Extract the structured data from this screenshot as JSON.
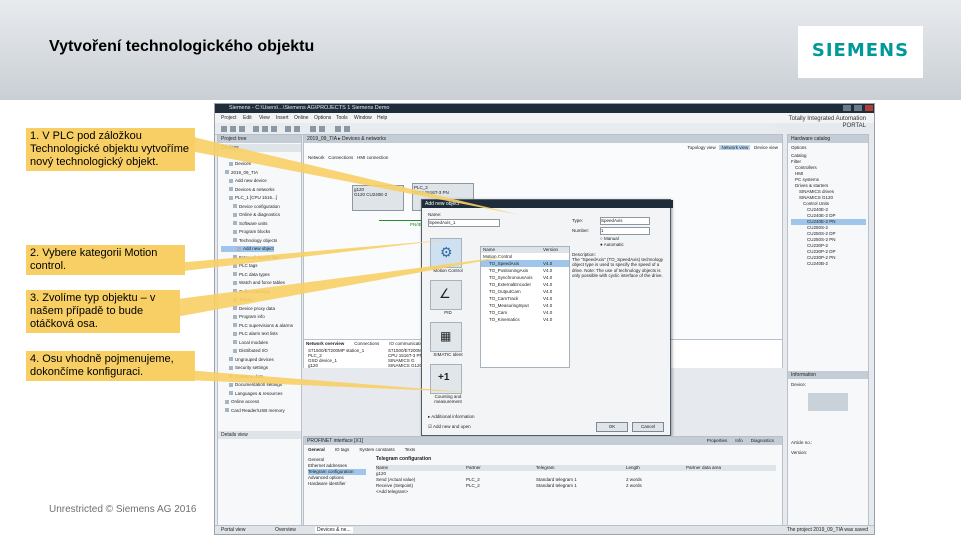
{
  "slide": {
    "title": "Vytvoření technologického objektu",
    "logo": "SIEMENS",
    "footer": "Unrestricted © Siemens AG 2016"
  },
  "callouts": [
    {
      "text": "1. V PLC pod záložkou Technologické objektu vytvoříme nový technologický objekt."
    },
    {
      "text": "2. Vybere kategorii Motion control."
    },
    {
      "text": "3. Zvolíme typ objektu – v našem případě to bude otáčková osa."
    },
    {
      "text": "4. Osu vhodně pojmenujeme, dokončíme konfiguraci."
    }
  ],
  "accent_colors": {
    "callout": "#f7cf65",
    "logo": "#009999",
    "title_bar": "#1f2d3b"
  },
  "tia": {
    "window_title": "Siemens - C:\\Users\\...\\Siemens AG\\PROJECTS 1 Siemens Demo",
    "brand_line1": "Totally Integrated Automation",
    "brand_line2": "PORTAL",
    "menu": [
      "Project",
      "Edit",
      "View",
      "Insert",
      "Online",
      "Options",
      "Tools",
      "Window",
      "Help"
    ],
    "project_tree_title": "Project tree",
    "devices_tab": "Devices",
    "tree_items": [
      "Devices",
      "2019_09_TIA",
      "Add new device",
      "Devices & networks",
      "PLC_1 [CPU 1516...]",
      "Device configuration",
      "Online & diagnostics",
      "Software units",
      "Program blocks",
      "Technology objects",
      "Add new object",
      "External source files",
      "PLC tags",
      "PLC data types",
      "Watch and force tables",
      "Online backups",
      "Traces",
      "Device proxy data",
      "Program info",
      "PLC supervisions & alarms",
      "PLC alarm text lists",
      "Local modules",
      "Distributed I/O",
      "Ungrouped devices",
      "Security settings",
      "Common data",
      "Documentation settings",
      "Languages & resources",
      "Online access",
      "Card Reader/USB memory"
    ],
    "details_view": "Details view",
    "breadcrumb": "2019_09_TIA ▸ Devices & networks",
    "view_tabs": [
      "Topology view",
      "Network view",
      "Device view"
    ],
    "net_toolbar": [
      "Network",
      "Connections",
      "HMI connection"
    ],
    "devices": [
      {
        "name": "g120",
        "sub": "G120 CU240E-2"
      },
      {
        "name": "PLC_2",
        "sub": "CPU 1516T-3 PN"
      }
    ],
    "net_label": "PN/IE_1",
    "dialog": {
      "title": "Add new object",
      "name_label": "Name:",
      "name_value": "SpeedAxis_1",
      "categories": [
        "Motion Control",
        "PID",
        "SIMATIC Ident",
        "Counting and measurement"
      ],
      "list_header": [
        "Name",
        "Version"
      ],
      "list_items": [
        {
          "name": "Motion Control",
          "ver": ""
        },
        {
          "name": "TO_SpeedAxis",
          "ver": "V4.0"
        },
        {
          "name": "TO_PositioningAxis",
          "ver": "V4.0"
        },
        {
          "name": "TO_SynchronousAxis",
          "ver": "V4.0"
        },
        {
          "name": "TO_ExternalEncoder",
          "ver": "V4.0"
        },
        {
          "name": "TO_OutputCam",
          "ver": "V4.0"
        },
        {
          "name": "TO_CamTrack",
          "ver": "V4.0"
        },
        {
          "name": "TO_MeasuringInput",
          "ver": "V4.0"
        },
        {
          "name": "TO_Cam",
          "ver": "V4.0"
        },
        {
          "name": "TO_Kinematics",
          "ver": "V4.0"
        }
      ],
      "type_label": "Type:",
      "type_value": "SpeedAxis",
      "number_label": "Number:",
      "number_value": "1",
      "radio_manual": "Manual",
      "radio_auto": "Automatic",
      "description_label": "Description:",
      "description": "The \"SpeedAxis\" (TO_SpeedAxis) technology object type is used to specify the speed of a drive. Note: The use of technology objects is only possible with cyclic interface of the drive.",
      "additional_info": "Additional information",
      "add_and_open": "Add new and open",
      "ok": "OK",
      "cancel": "Cancel"
    },
    "network_overview_tabs": [
      "Network overview",
      "Connections",
      "IO communication",
      "VPN"
    ],
    "overview_rows": [
      {
        "device": "S71500/ET200MP station_1",
        "type": "S71500/ET200MP station"
      },
      {
        "device": "PLC_2",
        "type": "CPU 1516T-3 PN/DP"
      },
      {
        "device": "GSD device_1",
        "type": "SINAMICS G"
      },
      {
        "device": "g120",
        "type": "SINAMICS G120"
      }
    ],
    "props_title": "PROFINET interface [X1]",
    "props_tabs": [
      "Properties",
      "Info",
      "Diagnostics"
    ],
    "props_subtabs": [
      "General",
      "IO tags",
      "System constants",
      "Texts"
    ],
    "props_nav": [
      "General",
      "Ethernet addresses",
      "Telegram configuration",
      "Advanced options",
      "Hardware identifier"
    ],
    "telegram_title": "Telegram configuration",
    "telegram_header": [
      "Name",
      "Partner",
      "Telegram",
      "Length",
      "Partner data area"
    ],
    "telegram_rows": [
      {
        "name": "g120",
        "partner": "",
        "telegram": "",
        "length": ""
      },
      {
        "name": "Send (Actual value)",
        "partner": "PLC_2",
        "telegram": "Standard telegram 1",
        "length": "2 words"
      },
      {
        "name": "Receive (Setpoint)",
        "partner": "PLC_2",
        "telegram": "Standard telegram 1",
        "length": "2 words"
      },
      {
        "name": "<Add telegram>",
        "partner": "",
        "telegram": "",
        "length": ""
      }
    ],
    "catalog_title": "Hardware catalog",
    "catalog_options": "Options",
    "catalog_items": [
      "Catalog",
      "Filter",
      "Controllers",
      "HMI",
      "PC systems",
      "Drives & starters",
      "SINAMICS drives",
      "SINAMICS G120",
      "Control Units",
      "CU240E-2",
      "CU240E-2 DP",
      "CU240E-2 PN",
      "CU250S-2",
      "CU250S-2 DP",
      "CU250S-2 PN",
      "CU230P-2",
      "CU230P-2 DP",
      "CU230P-2 PN",
      "CU240B-2"
    ],
    "information_title": "Information",
    "info_device": "Device:",
    "info_article": "Article no.:",
    "info_version": "Version:",
    "bottom_portal": "Portal view",
    "bottom_tabs": [
      "Overview",
      "Devices & ne..."
    ],
    "bottom_status": "The project 2019_09_TIA was saved"
  }
}
